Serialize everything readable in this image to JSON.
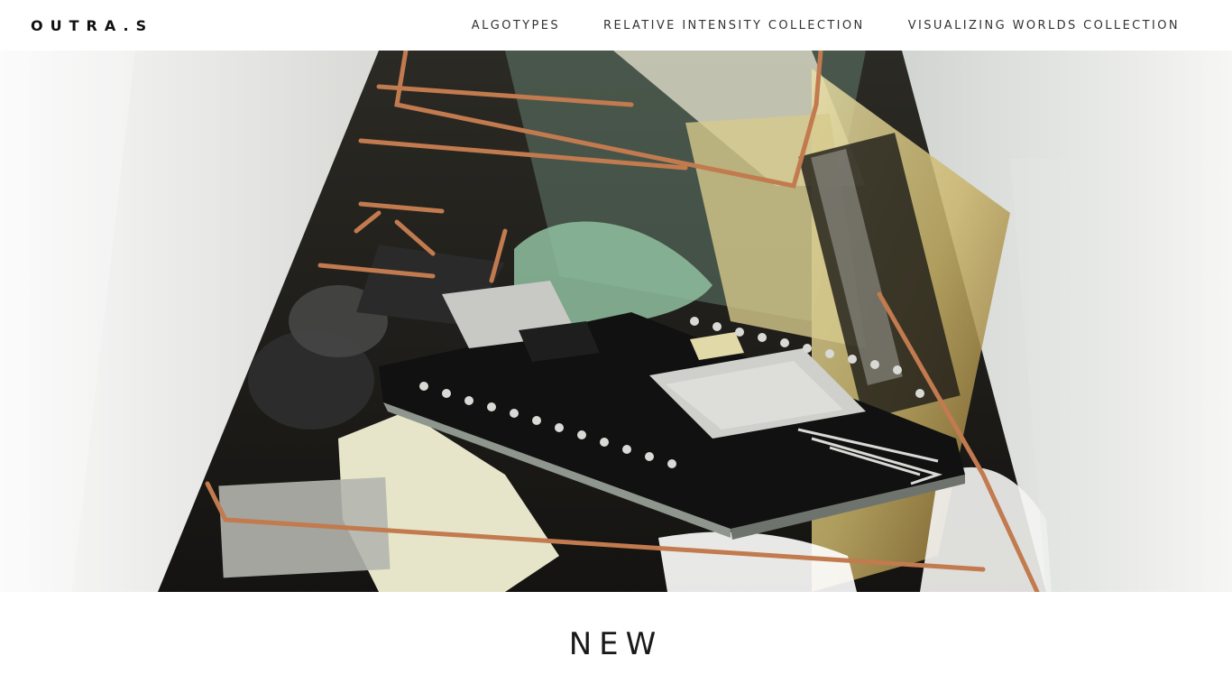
{
  "header": {
    "brand": "OUTRA.S",
    "nav": [
      {
        "label": "ALGOTYPES"
      },
      {
        "label": "RELATIVE INTENSITY COLLECTION"
      },
      {
        "label": "VISUALIZING WORLDS COLLECTION"
      }
    ]
  },
  "hero": {
    "colors": {
      "copper": "#c27a4f",
      "resin": "#f1efe9",
      "pcb": "#151515"
    }
  },
  "main": {
    "section_title": "NEW"
  }
}
